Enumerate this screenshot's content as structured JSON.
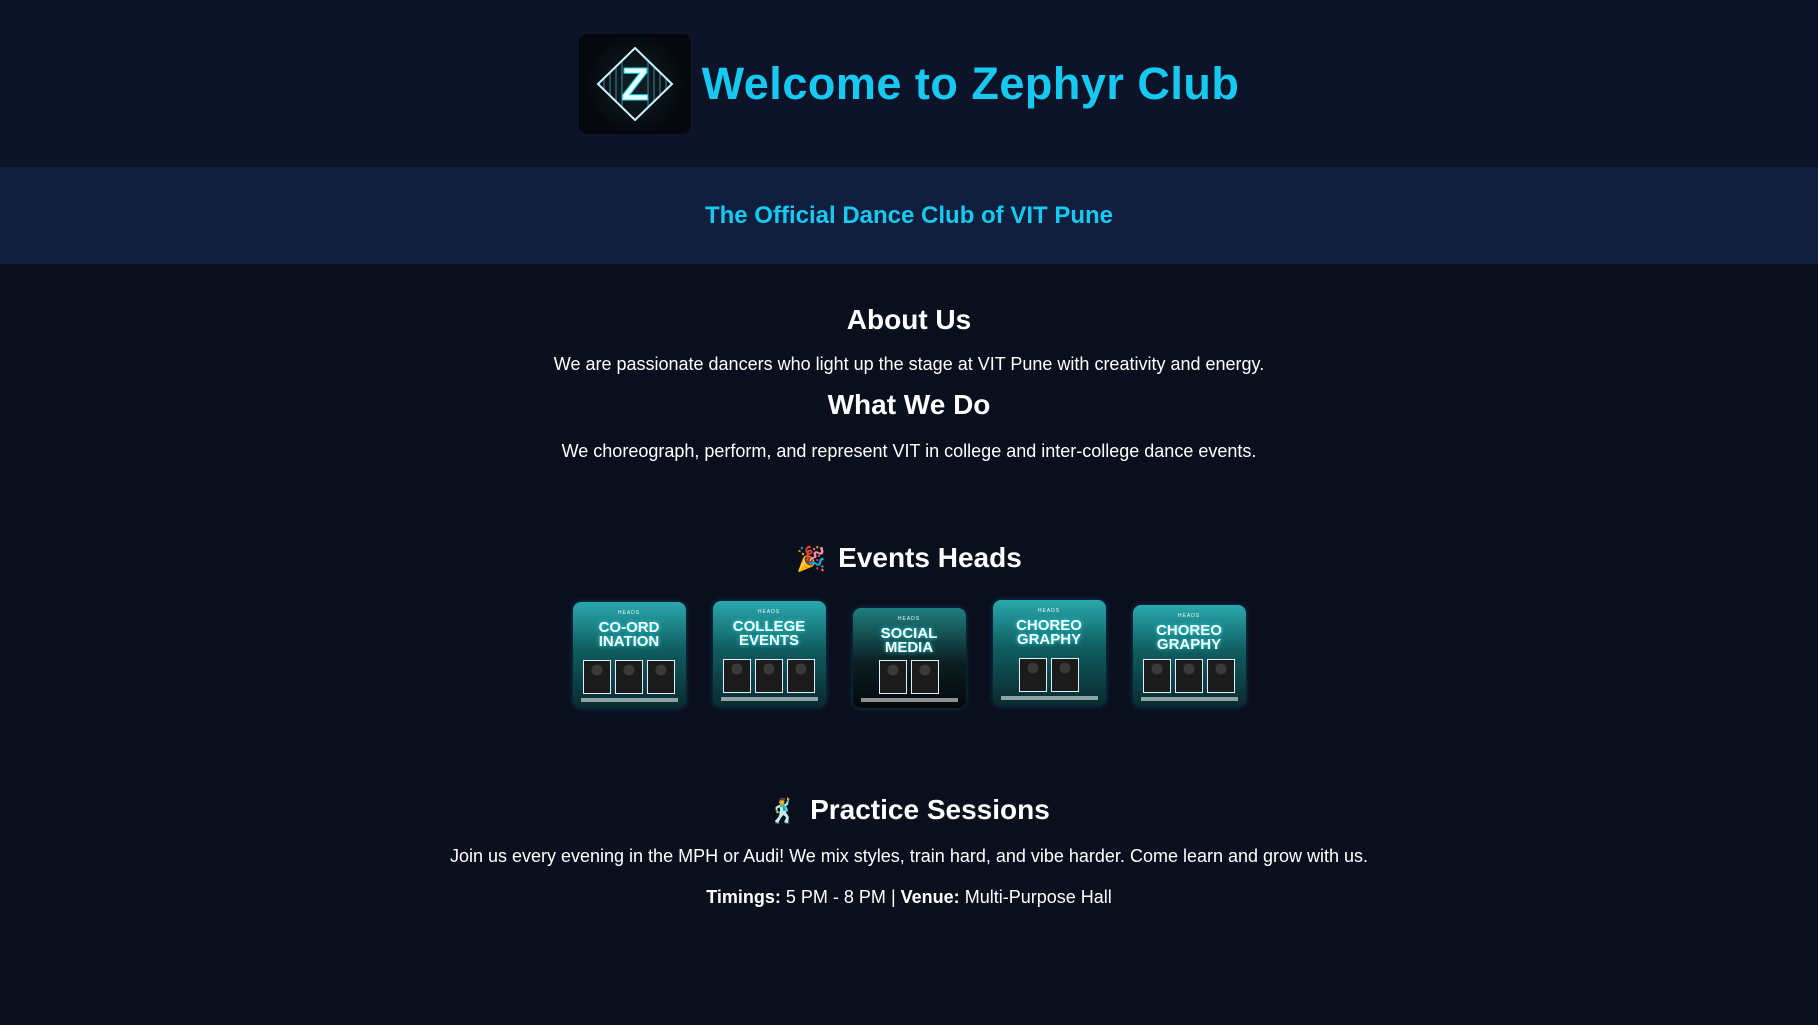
{
  "header": {
    "title": "Welcome to Zephyr Club",
    "logo_letter": "Z"
  },
  "tagline": "The Official Dance Club of VIT Pune",
  "about": {
    "heading": "About Us",
    "text": "We are passionate dancers who light up the stage at VIT Pune with creativity and energy."
  },
  "what_we_do": {
    "heading": "What We Do",
    "text": "We choreograph, perform, and represent VIT in college and inter-college dance events."
  },
  "events_heads": {
    "emoji": "🎉",
    "heading": "Events Heads",
    "cards": [
      {
        "kicker": "HEADS",
        "line1": "CO-ORD",
        "line2": "INATION"
      },
      {
        "kicker": "HEADS",
        "line1": "COLLEGE",
        "line2": "EVENTS"
      },
      {
        "kicker": "HEADS",
        "line1": "SOCIAL",
        "line2": "MEDIA"
      },
      {
        "kicker": "HEADS",
        "line1": "CHOREO",
        "line2": "GRAPHY"
      },
      {
        "kicker": "HEADS",
        "line1": "CHOREO",
        "line2": "GRAPHY"
      }
    ]
  },
  "practice": {
    "emoji": "🕺",
    "heading": "Practice Sessions",
    "text": "Join us every evening in the MPH or Audi! We mix styles, train hard, and vibe harder. Come learn and grow with us.",
    "timings_label": "Timings:",
    "timings_value": "5 PM - 8 PM",
    "separator": "|",
    "venue_label": "Venue:",
    "venue_value": "Multi-Purpose Hall"
  },
  "colors": {
    "accent": "#16c9f0",
    "background": "#0a0f1e",
    "header_bg": "#0d1429",
    "tagline_bg": "#0f1f3d"
  }
}
